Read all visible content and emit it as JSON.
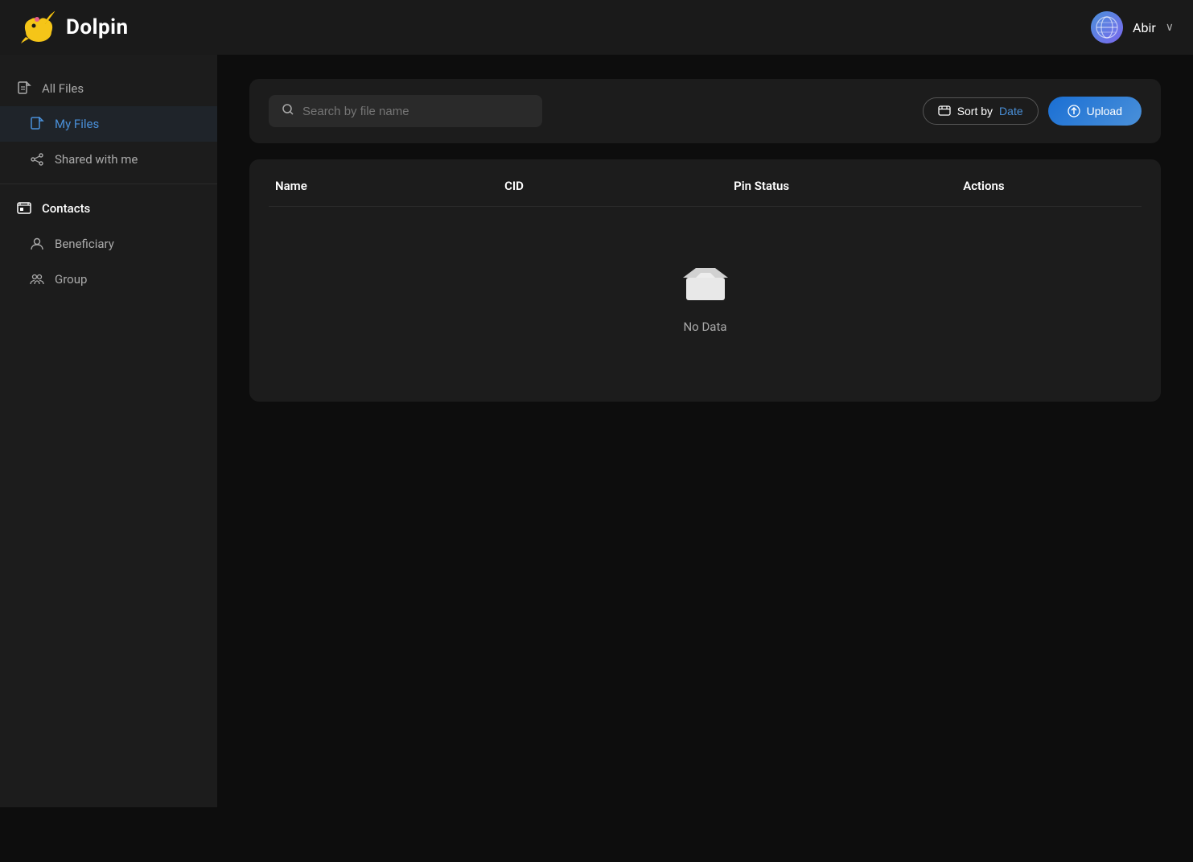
{
  "header": {
    "logo_text": "Dolpin",
    "user_name": "Abir",
    "chevron": "∨"
  },
  "sidebar": {
    "items": [
      {
        "id": "all-files",
        "label": "All Files",
        "icon": "file",
        "active": false,
        "sub": false
      },
      {
        "id": "my-files",
        "label": "My Files",
        "icon": "file-blue",
        "active": true,
        "sub": true
      },
      {
        "id": "shared-with-me",
        "label": "Shared with me",
        "icon": "share",
        "active": false,
        "sub": true
      },
      {
        "id": "contacts",
        "label": "Contacts",
        "icon": "contacts",
        "active": false,
        "sub": false,
        "section": true
      },
      {
        "id": "beneficiary",
        "label": "Beneficiary",
        "icon": "person",
        "active": false,
        "sub": true
      },
      {
        "id": "group",
        "label": "Group",
        "icon": "group",
        "active": false,
        "sub": true
      }
    ]
  },
  "toolbar": {
    "search_placeholder": "Search by file name",
    "sort_button_label": "Sort by ",
    "sort_by_value": "Date",
    "upload_button_label": "Upload"
  },
  "table": {
    "columns": [
      "Name",
      "CID",
      "Pin Status",
      "Actions"
    ],
    "no_data_text": "No Data"
  }
}
